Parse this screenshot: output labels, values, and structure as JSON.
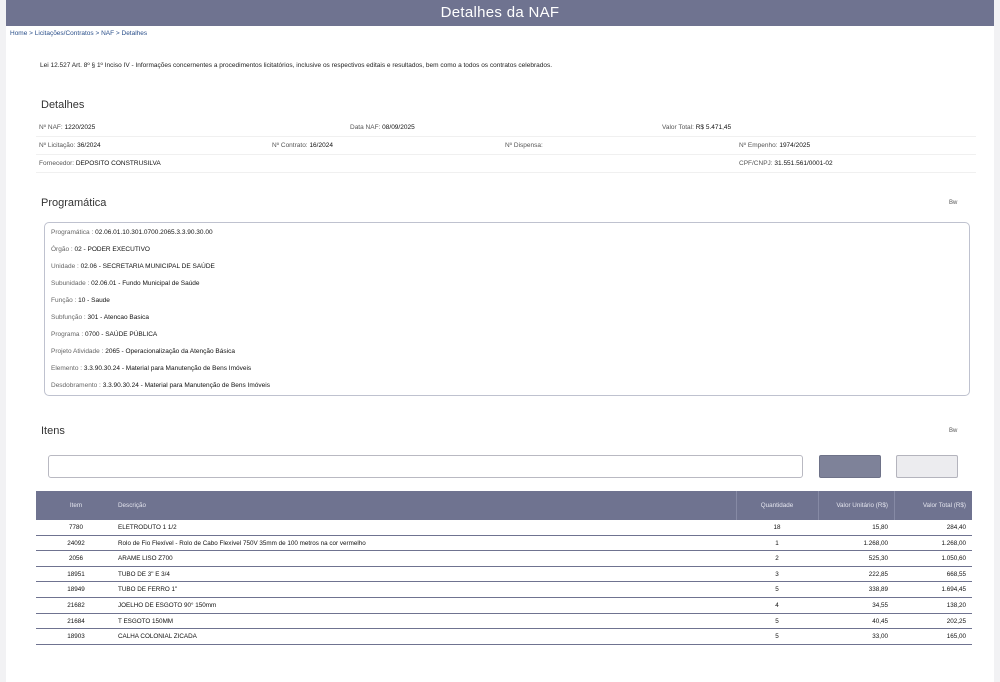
{
  "header": {
    "title": "Detalhes  da NAF"
  },
  "breadcrumb": {
    "home": "Home",
    "sep1": ">",
    "licitacoes": "Licitações/Contratos",
    "sep2": ">",
    "naf": "NAF",
    "sep3": ">",
    "current": "Detalhes"
  },
  "law_text": "Lei 12.527 Art. 8º § 1º Inciso IV - Informações concernentes a procedimentos licitatórios, inclusive os respectivos editais e resultados, bem como a todos os contratos celebrados.",
  "detalhes": {
    "title": "Detalhes",
    "naf_label": "Nº NAF:",
    "naf_value": "1220/2025",
    "data_label": "Data NAF:",
    "data_value": "08/09/2025",
    "valor_label": "Valor Total:",
    "valor_value": "R$ 5.471,45",
    "licitacao_label": "Nº Licitação:",
    "licitacao_value": "36/2024",
    "contrato_label": "Nº Contrato:",
    "contrato_value": "16/2024",
    "dispensa_label": "Nº Dispensa:",
    "dispensa_value": "",
    "empenho_label": "Nº Empenho:",
    "empenho_value": "1974/2025",
    "fornecedor_label": "Fornecedor:",
    "fornecedor_value": "DEPOSITO CONSTRUSILVA",
    "cpf_label": "CPF/CNPJ:",
    "cpf_value": "31.551.561/0001-02"
  },
  "programatica": {
    "title": "Programática",
    "bw": "Bw",
    "lines": [
      {
        "label": "Programática :",
        "value": "02.06.01.10.301.0700.2065.3.3.90.30.00"
      },
      {
        "label": "Órgão :",
        "value": "02 - PODER EXECUTIVO"
      },
      {
        "label": "Unidade :",
        "value": "02.06 - SECRETARIA MUNICIPAL DE SAÚDE"
      },
      {
        "label": "Subunidade :",
        "value": "02.06.01 - Fundo Municipal de Saúde"
      },
      {
        "label": "Função :",
        "value": "10 - Saude"
      },
      {
        "label": "Subfunção :",
        "value": "301 - Atencao Basica"
      },
      {
        "label": "Programa :",
        "value": "0700 - SAÚDE PÚBLICA"
      },
      {
        "label": "Projeto Atividade :",
        "value": "2065 - Operacionalização da Atenção Básica"
      },
      {
        "label": "Elemento :",
        "value": "3.3.90.30.24 - Material para Manutenção de Bens Imóveis"
      },
      {
        "label": "Desdobramento :",
        "value": "3.3.90.30.24 - Material para Manutenção de Bens Imóveis"
      }
    ]
  },
  "itens": {
    "title": "Itens",
    "bw": "Bw",
    "search_value": "",
    "columns": {
      "item": "Item",
      "descricao": "Descrição",
      "quantidade": "Quantidade",
      "valor_unitario": "Valor Unitário (R$)",
      "valor_total": "Valor Total (R$)"
    },
    "rows": [
      {
        "item": "7780",
        "descricao": "ELETRODUTO 1 1/2",
        "quantidade": "18",
        "valor_unitario": "15,80",
        "valor_total": "284,40"
      },
      {
        "item": "24092",
        "descricao": "Rolo de Fio Flexível - Rolo de Cabo Flexível 750V 35mm de 100 metros na cor vermelho",
        "quantidade": "1",
        "valor_unitario": "1.268,00",
        "valor_total": "1.268,00"
      },
      {
        "item": "2056",
        "descricao": "ARAME LISO Z700",
        "quantidade": "2",
        "valor_unitario": "525,30",
        "valor_total": "1.050,60"
      },
      {
        "item": "18951",
        "descricao": "TUBO DE 3\" E 3/4",
        "quantidade": "3",
        "valor_unitario": "222,85",
        "valor_total": "668,55"
      },
      {
        "item": "18949",
        "descricao": "TUBO DE FERRO 1\"",
        "quantidade": "5",
        "valor_unitario": "338,89",
        "valor_total": "1.694,45"
      },
      {
        "item": "21682",
        "descricao": "JOELHO DE ESGOTO 90° 150mm",
        "quantidade": "4",
        "valor_unitario": "34,55",
        "valor_total": "138,20"
      },
      {
        "item": "21684",
        "descricao": "T ESGOTO 150MM",
        "quantidade": "5",
        "valor_unitario": "40,45",
        "valor_total": "202,25"
      },
      {
        "item": "18903",
        "descricao": "CALHA COLONIAL ZICADA",
        "quantidade": "5",
        "valor_unitario": "33,00",
        "valor_total": "165,00"
      }
    ]
  }
}
